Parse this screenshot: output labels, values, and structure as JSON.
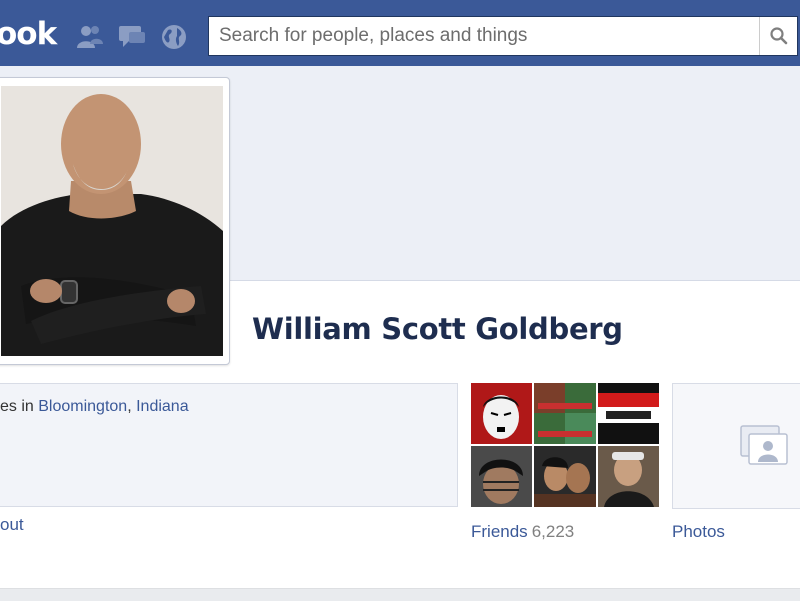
{
  "header": {
    "logo_text": "ook",
    "search": {
      "placeholder": "Search for people, places and things"
    }
  },
  "profile": {
    "name": "William Scott Goldberg",
    "about": {
      "lives_prefix": "es in",
      "city": "Bloomington",
      "separator": ",",
      "state": "Indiana",
      "link_label": "out"
    }
  },
  "friends": {
    "label": "Friends",
    "count": "6,223"
  },
  "photos": {
    "label": "Photos"
  },
  "colors": {
    "brand_blue": "#3b5998",
    "link": "#3b5998",
    "cover": "#eceff6"
  },
  "icons": [
    "friend-requests-icon",
    "messages-icon",
    "notifications-globe-icon",
    "search-icon",
    "photos-placeholder-icon"
  ]
}
